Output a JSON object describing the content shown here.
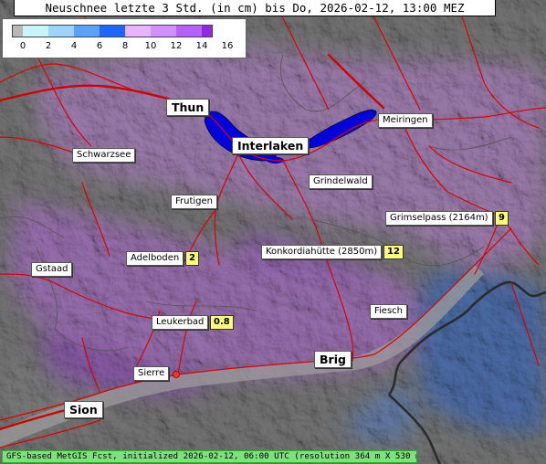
{
  "title": "Neuschnee letzte 3 Std. (in cm) bis Do, 2026-02-12, 13:00 MEZ",
  "legend": {
    "colors": [
      "#b8b8b8",
      "#c8f4ff",
      "#9ad4ff",
      "#5aa2ff",
      "#1e64ff",
      "#e8b4ff",
      "#d090ff",
      "#b860ff",
      "#9428e0"
    ],
    "ticks": [
      "0",
      "2",
      "4",
      "6",
      "8",
      "10",
      "12",
      "14",
      "16"
    ]
  },
  "places": [
    {
      "name": "Thun",
      "big": true
    },
    {
      "name": "Interlaken",
      "big": true
    },
    {
      "name": "Meiringen",
      "big": false
    },
    {
      "name": "Schwarzsee",
      "big": false
    },
    {
      "name": "Grindelwald",
      "big": false
    },
    {
      "name": "Frutigen",
      "big": false
    },
    {
      "name": "Grimselpass (2164m)",
      "big": false,
      "value": "9"
    },
    {
      "name": "Konkordiahütte (2850m)",
      "big": false,
      "value": "12"
    },
    {
      "name": "Adelboden",
      "big": false,
      "value": "2"
    },
    {
      "name": "Gstaad",
      "big": false
    },
    {
      "name": "Fiesch",
      "big": false
    },
    {
      "name": "Leukerbad",
      "big": false,
      "value": "0.8"
    },
    {
      "name": "Brig",
      "big": true
    },
    {
      "name": "Sierre",
      "big": false
    },
    {
      "name": "Sion",
      "big": true
    }
  ],
  "footer": "GFS-based MetGIS Fcst, initialized 2026-02-12, 06:00 UTC (resolution 364 m X 530 m)"
}
